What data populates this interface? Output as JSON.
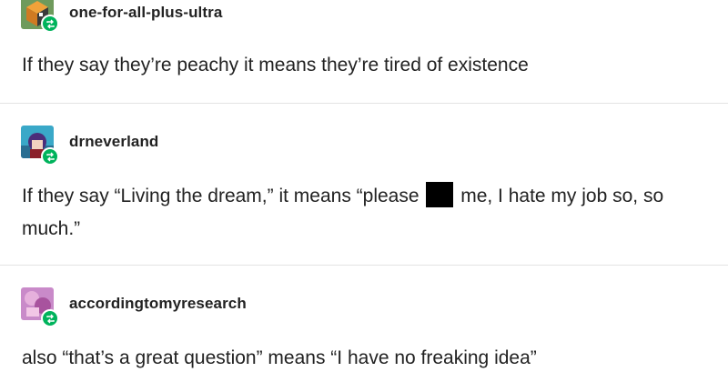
{
  "posts": [
    {
      "username": "one-for-all-plus-ultra",
      "avatar_icon": "cube-avatar-icon",
      "text": "If they say they’re peachy it means they’re tired of existence"
    },
    {
      "username": "drneverland",
      "avatar_icon": "anime-character-avatar-icon",
      "text_before": "If they say “Living the dream,” it means “please",
      "text_after": "me, I hate my job so, so much.”"
    },
    {
      "username": "accordingtomyresearch",
      "avatar_icon": "pink-art-avatar-icon",
      "text": "also “that’s a great question” means “I have no freaking idea”"
    }
  ],
  "colors": {
    "reblog_badge": "#00b35c",
    "divider": "#e3e3e3",
    "text": "#222222"
  }
}
